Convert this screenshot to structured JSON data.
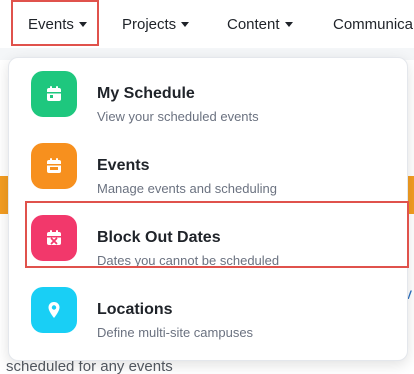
{
  "nav": {
    "items": [
      {
        "label": "Events",
        "has_caret": true
      },
      {
        "label": "Projects",
        "has_caret": true
      },
      {
        "label": "Content",
        "has_caret": true
      },
      {
        "label": "Communica",
        "has_caret": false
      }
    ]
  },
  "dropdown": {
    "items": [
      {
        "title": "My Schedule",
        "subtitle": "View your scheduled events",
        "icon": "calendar-icon",
        "color": "#1ec77e"
      },
      {
        "title": "Events",
        "subtitle": "Manage events and scheduling",
        "icon": "calendar-event-icon",
        "color": "#f7901e"
      },
      {
        "title": "Block Out Dates",
        "subtitle": "Dates you cannot be scheduled",
        "icon": "calendar-x-icon",
        "color": "#f2386b"
      },
      {
        "title": "Locations",
        "subtitle": "Define multi-site campuses",
        "icon": "map-pin-icon",
        "color": "#19cff5"
      }
    ]
  },
  "background": {
    "link_fragment": "v",
    "text_fragment": "scheduled for any events"
  },
  "colors": {
    "highlight_outline": "#e0524c",
    "orange_band": "#f39d22"
  }
}
